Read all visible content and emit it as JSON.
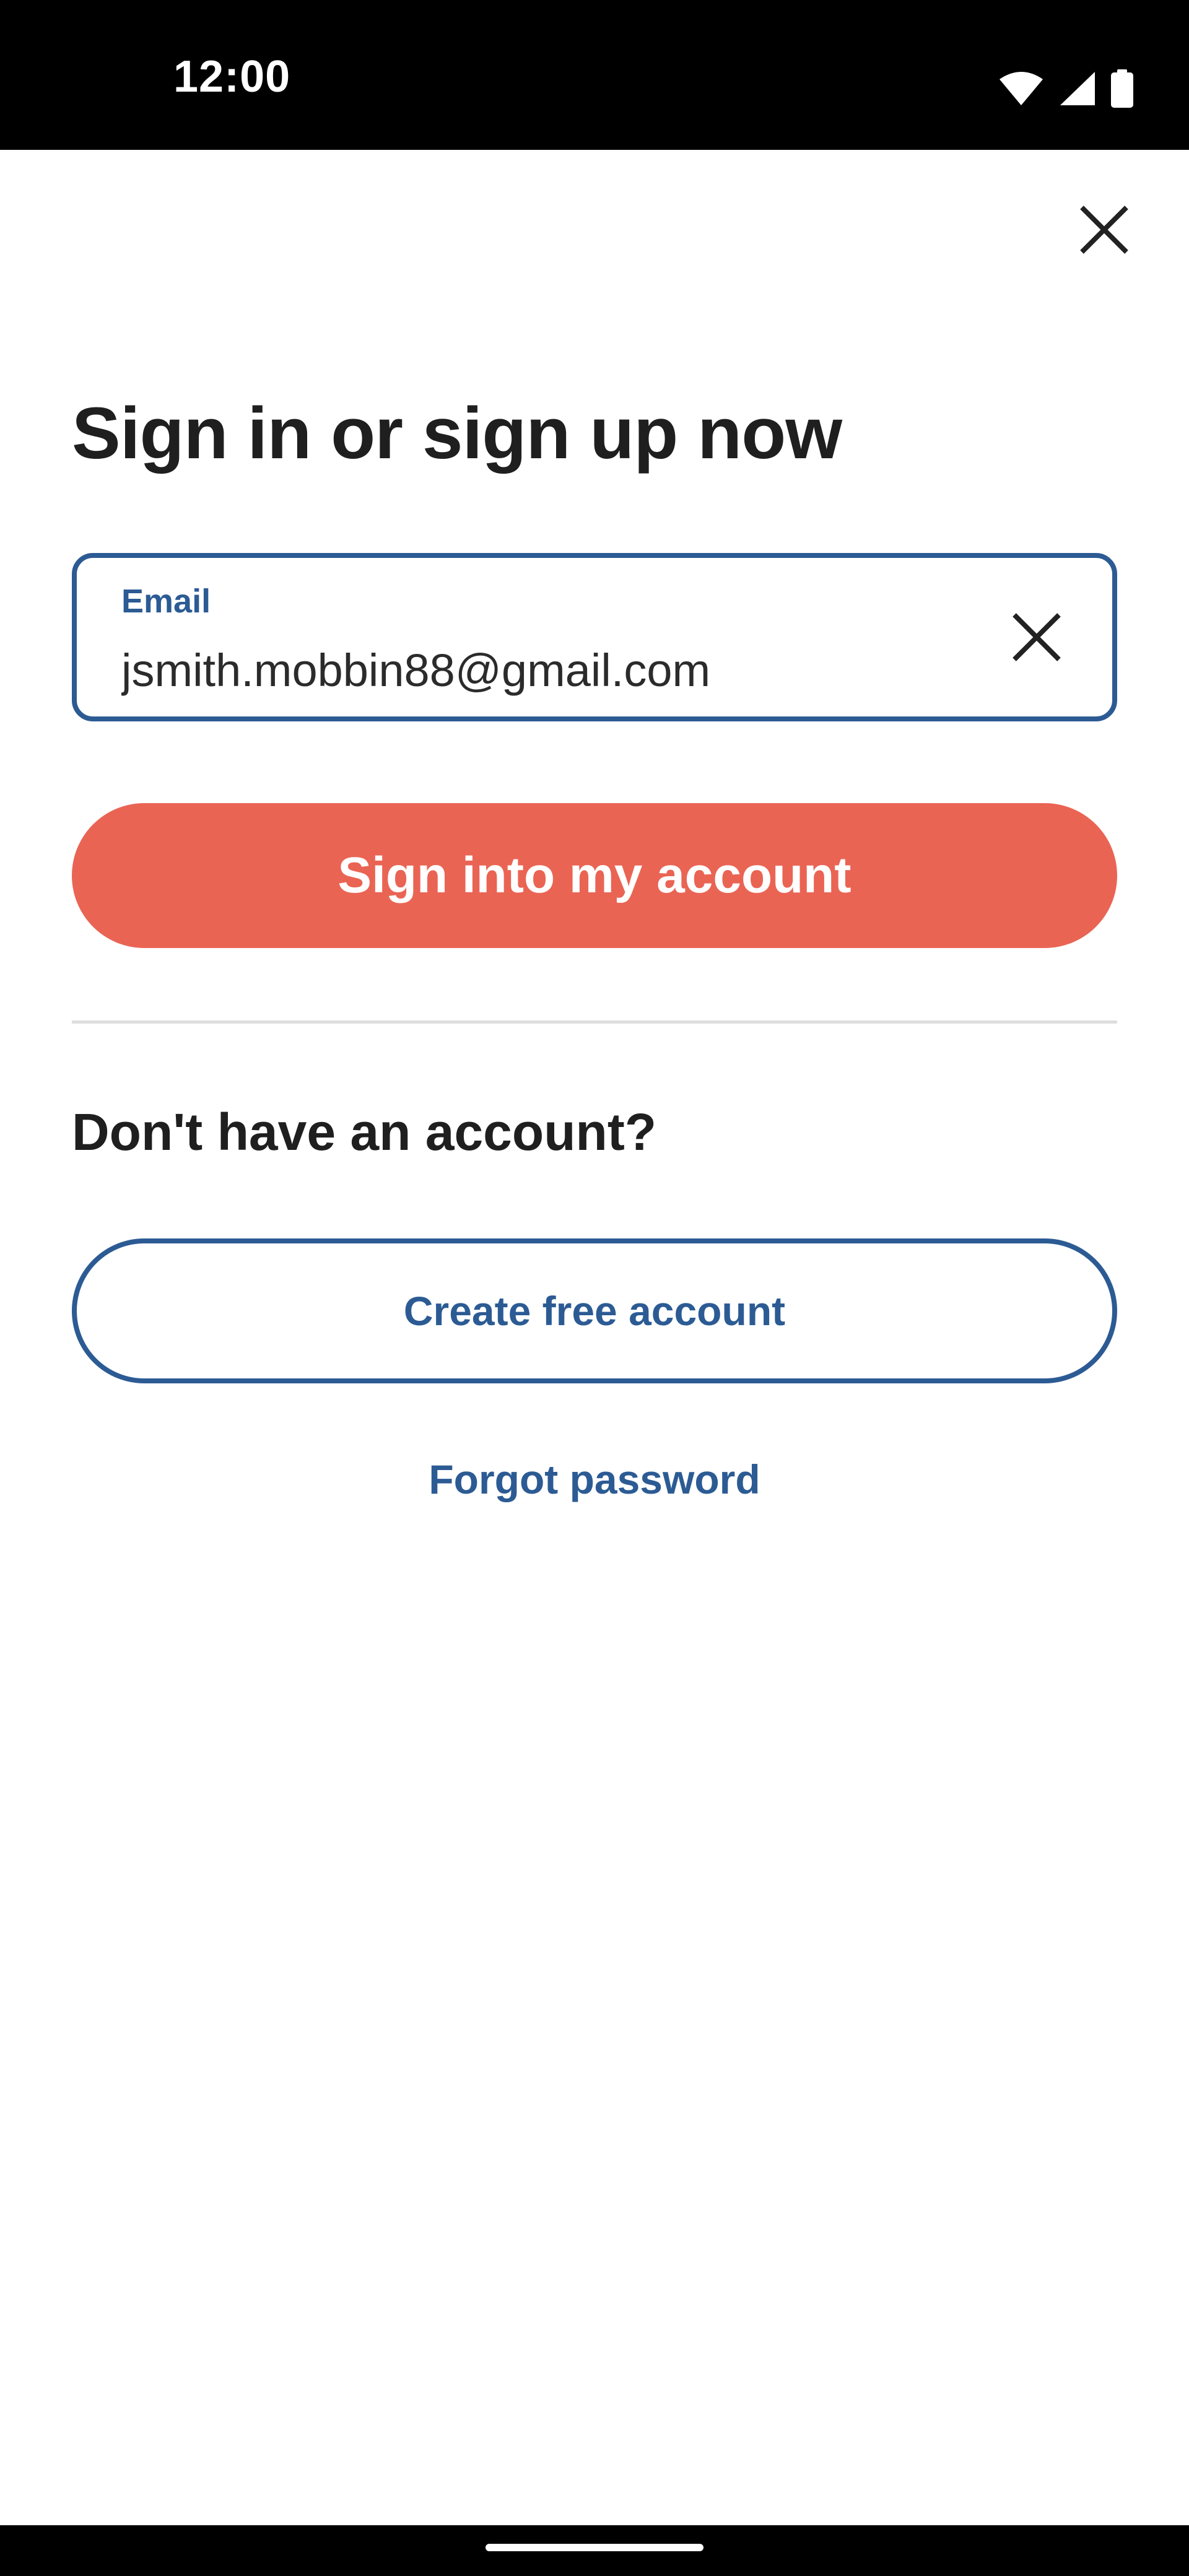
{
  "status_bar": {
    "time": "12:00",
    "icons": [
      "wifi-icon",
      "cellular-signal-icon",
      "battery-icon"
    ]
  },
  "header": {
    "close_icon": "close-icon"
  },
  "title": "Sign in or sign up now",
  "email_field": {
    "label": "Email",
    "value": "jsmith.mobbin88@gmail.com",
    "clear_icon": "clear-icon"
  },
  "primary_button": {
    "label": "Sign into my account"
  },
  "signup_section": {
    "heading": "Don't have an account?",
    "create_button_label": "Create free account",
    "forgot_password_label": "Forgot password"
  },
  "colors": {
    "accent_blue": "#2c5b94",
    "primary_coral": "#ea6454",
    "text_dark": "#1f1f1f",
    "divider": "#dedede"
  }
}
